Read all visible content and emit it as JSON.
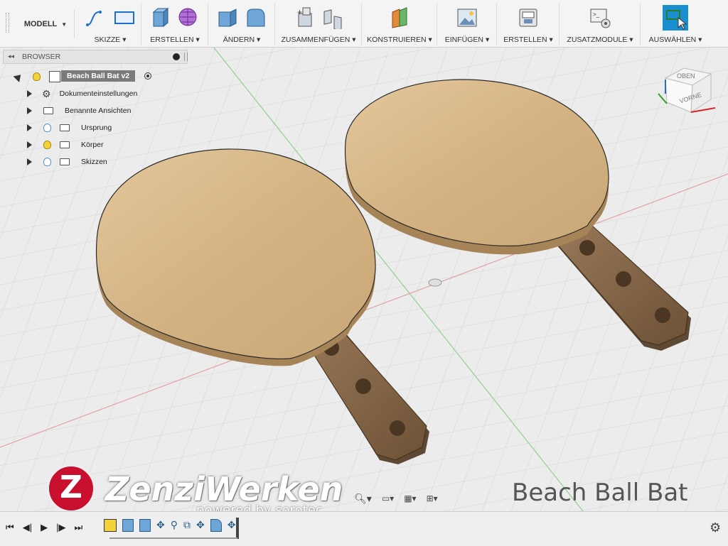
{
  "toolbar": {
    "mode_label": "MODELL",
    "groups": [
      {
        "label": "SKIZZE"
      },
      {
        "label": "ERSTELLEN"
      },
      {
        "label": "ÄNDERN"
      },
      {
        "label": "ZUSAMMENFÜGEN"
      },
      {
        "label": "KONSTRUIEREN"
      },
      {
        "label": "EINFÜGEN"
      },
      {
        "label": "ERSTELLEN"
      },
      {
        "label": "ZUSATZMODULE"
      },
      {
        "label": "AUSWÄHLEN"
      }
    ]
  },
  "browser": {
    "title": "BROWSER",
    "root": "Beach Ball Bat v2",
    "items": [
      {
        "label": "Dokumenteinstellungen"
      },
      {
        "label": "Benannte Ansichten"
      },
      {
        "label": "Ursprung"
      },
      {
        "label": "Körper"
      },
      {
        "label": "Skizzen"
      }
    ]
  },
  "viewcube": {
    "top": "OBEN",
    "front": "VORNE"
  },
  "watermark": {
    "logo_letter": "Z",
    "brand": "ZenziWerken",
    "tagline": "powered by sorotec",
    "title": "Beach Ball Bat"
  },
  "colors": {
    "accent": "#1a8fd0",
    "wood": "#d9b98a",
    "handle": "#8a6a4c",
    "logo_red": "#c8102e"
  }
}
